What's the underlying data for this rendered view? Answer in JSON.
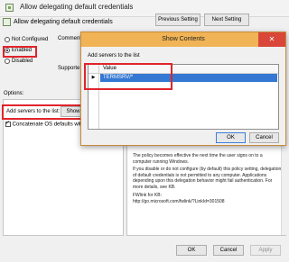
{
  "window": {
    "title": "Allow delegating default credentials",
    "setting_name": "Allow delegating default credentials",
    "prev_button": "Previous Setting",
    "next_button": "Next Setting"
  },
  "state": {
    "not_configured": "Not Configured",
    "enabled": "Enabled",
    "disabled": "Disabled",
    "selected": "Enabled"
  },
  "fields": {
    "comment_label": "Comment",
    "supported_label": "Supporte",
    "options_label": "Options:"
  },
  "options": {
    "add_servers_label": "Add servers to the list:",
    "show_button": "Show",
    "concatenate_label": "Concatenate OS defaults with",
    "concatenate_checked": true
  },
  "help": {
    "p1": "The policy becomes effective the next time the user signs on to a computer running Windows.",
    "p2": "If you disable or do not configure (by default) this policy setting, delegation of default credentials is not permitted to any computer. Applications depending upon this delegation behavior might fail authentication. For more details, see KB.",
    "p3_line1": "FWlink for KB:",
    "p3_line2": "http://go.microsoft.com/fwlink/?LinkId=301508"
  },
  "footer": {
    "ok": "OK",
    "cancel": "Cancel",
    "apply": "Apply"
  },
  "dialog": {
    "title": "Show Contents",
    "close_glyph": "✕",
    "heading": "Add servers to the list",
    "column_header": "Value",
    "row_marker": "▶",
    "rows": [
      "TERMSRV/*"
    ],
    "ok": "OK",
    "cancel": "Cancel"
  },
  "colors": {
    "highlight": "#e0242c",
    "dialog_title_bg": "#f0b456",
    "selected_cell": "#3478d3",
    "close_button": "#d9473a"
  }
}
